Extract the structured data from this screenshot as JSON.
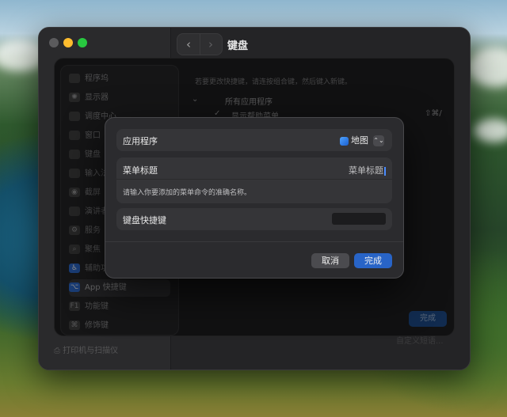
{
  "window": {
    "title": "键盘"
  },
  "sidebar_items": [
    {
      "label": "程序坞",
      "icon": "dock-icon"
    },
    {
      "label": "显示器",
      "icon": "display-icon"
    },
    {
      "label": "调度中心",
      "icon": "mission-control-icon"
    },
    {
      "label": "窗口",
      "icon": "window-icon"
    },
    {
      "label": "键盘",
      "icon": "keyboard-icon"
    },
    {
      "label": "输入法",
      "icon": "input-icon"
    },
    {
      "label": "截屏",
      "icon": "screenshot-icon"
    },
    {
      "label": "演讲者",
      "icon": "presenter-icon"
    },
    {
      "label": "服务",
      "icon": "services-icon"
    },
    {
      "label": "聚焦",
      "icon": "spotlight-icon"
    },
    {
      "label": "辅助功能",
      "icon": "accessibility-icon"
    },
    {
      "label": "App 快捷键",
      "icon": "app-shortcuts-icon"
    },
    {
      "label": "功能键",
      "icon": "function-keys-icon"
    },
    {
      "label": "修饰键",
      "icon": "modifier-keys-icon"
    }
  ],
  "bottom_sidebar": {
    "label": "打印机与扫描仪"
  },
  "background_pane": {
    "hint": "若要更改快捷键，请连按组合键，然后键入新键。",
    "group_label": "所有应用程序",
    "item_label": "显示帮助菜单",
    "item_shortcut": "⇧⌘/",
    "done_label": "完成",
    "custom_label": "自定义短语..."
  },
  "dialog": {
    "app_label": "应用程序",
    "app_value": "地图",
    "menu_title_label": "菜单标题",
    "menu_title_value": "菜单标题",
    "helper_text": "请输入你要添加的菜单命令的准确名称。",
    "shortcut_label": "键盘快捷键",
    "cancel_label": "取消",
    "done_label": "完成"
  },
  "icons": {
    "nav_back": "‹",
    "nav_forward": "›",
    "popup_chevron": "⌃⌄"
  },
  "colors": {
    "accent": "#2864c7",
    "dialog_bg": "#2b2b2e",
    "window_bg": "#242426"
  }
}
